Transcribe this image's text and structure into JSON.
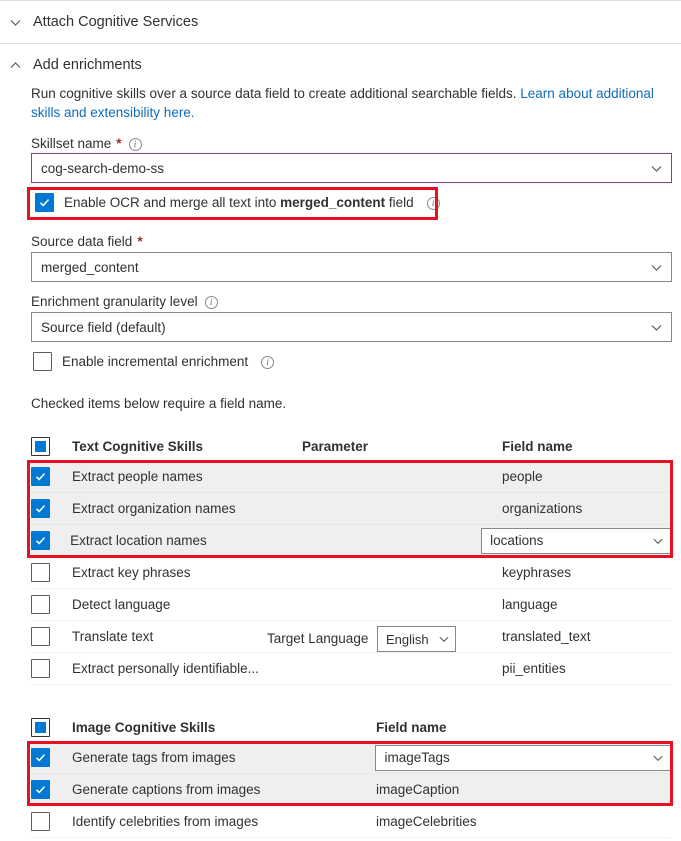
{
  "sections": {
    "attach_cognitive_services": {
      "title": "Attach Cognitive Services",
      "chevron": "chevron-down-icon"
    },
    "add_enrichments": {
      "title": "Add enrichments",
      "chevron": "chevron-up-icon"
    }
  },
  "description": {
    "text_before": "Run cognitive skills over a source data field to create additional searchable fields. ",
    "link_text": "Learn about additional skills and extensibility here.",
    "link_color": "#0f6cbd"
  },
  "form": {
    "skillset_name": {
      "label": "Skillset name",
      "required_marker": "*",
      "info_icon": "info-icon",
      "value": "cog-search-demo-ss",
      "chevron": "chevron-down-icon",
      "focus_border_color": "#8f3f8f"
    },
    "enable_ocr": {
      "label_before": "Enable OCR and merge all text into ",
      "label_bold": "merged_content",
      "label_after": " field",
      "checked": true,
      "info_icon": "info-icon"
    },
    "source_data_field": {
      "label": "Source data field",
      "required_marker": "*",
      "value": "merged_content",
      "chevron": "chevron-down-icon"
    },
    "enrichment_granularity": {
      "label": "Enrichment granularity level",
      "info_icon": "info-icon",
      "value": "Source field (default)",
      "chevron": "chevron-down-icon"
    },
    "enable_incremental": {
      "label": "Enable incremental enrichment",
      "checked": false,
      "info_icon": "info-icon"
    },
    "note": "Checked items below require a field name."
  },
  "text_skills_table": {
    "headers": {
      "skills": "Text Cognitive Skills",
      "parameter": "Parameter",
      "field_name": "Field name"
    },
    "header_checkbox_state": "indeterminate",
    "rows": [
      {
        "label": "Extract people names",
        "checked": true,
        "field_name": "people",
        "field_editable": false,
        "parameter": ""
      },
      {
        "label": "Extract organization names",
        "checked": true,
        "field_name": "organizations",
        "field_editable": false,
        "parameter": ""
      },
      {
        "label": "Extract location names",
        "checked": true,
        "field_name": "locations",
        "field_editable": true,
        "parameter": ""
      },
      {
        "label": "Extract key phrases",
        "checked": false,
        "field_name": "keyphrases",
        "field_editable": false,
        "parameter": ""
      },
      {
        "label": "Detect language",
        "checked": false,
        "field_name": "language",
        "field_editable": false,
        "parameter": ""
      },
      {
        "label": "Translate text",
        "checked": false,
        "field_name": "translated_text",
        "field_editable": false,
        "parameter": "Target Language",
        "parameter_value": "English"
      },
      {
        "label": "Extract personally identifiable...",
        "checked": false,
        "field_name": "pii_entities",
        "field_editable": false,
        "parameter": ""
      }
    ]
  },
  "image_skills_table": {
    "headers": {
      "skills": "Image Cognitive Skills",
      "field_name": "Field name"
    },
    "header_checkbox_state": "indeterminate",
    "rows": [
      {
        "label": "Generate tags from images",
        "checked": true,
        "field_name": "imageTags",
        "field_editable": true
      },
      {
        "label": "Generate captions from images",
        "checked": true,
        "field_name": "imageCaption",
        "field_editable": false
      },
      {
        "label": "Identify celebrities from images",
        "checked": false,
        "field_name": "imageCelebrities",
        "field_editable": false
      }
    ]
  },
  "highlights": {
    "color": "#e81123",
    "boxes": [
      {
        "name": "ocr-checkbox-highlight"
      },
      {
        "name": "text-skills-selected-rows-highlight"
      },
      {
        "name": "image-skills-selected-rows-highlight"
      }
    ]
  }
}
